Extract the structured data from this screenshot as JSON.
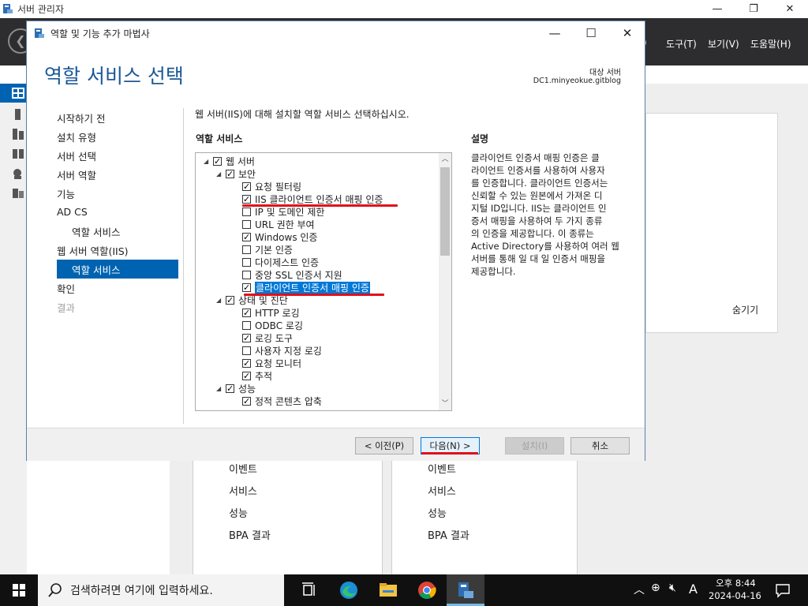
{
  "server_manager": {
    "title": "서버 관리자",
    "menu": [
      "도구(T)",
      "보기(V)",
      "도움말(H)"
    ],
    "partial_menu": ")",
    "hide_label": "숨기기",
    "tiles": [
      {
        "links": [
          "이벤트",
          "서비스",
          "성능",
          "BPA 결과"
        ]
      },
      {
        "links": [
          "이벤트",
          "서비스",
          "성능",
          "BPA 결과"
        ]
      }
    ]
  },
  "wizard": {
    "title": "역할 및 기능 추가 마법사",
    "heading": "역할 서비스 선택",
    "destination_label": "대상 서버",
    "destination_value": "DC1.minyeokue.gitblog",
    "nav": [
      "시작하기 전",
      "설치 유형",
      "서버 선택",
      "서버 역할",
      "기능",
      "AD CS",
      "역할 서비스",
      "웹 서버 역할(IIS)",
      "역할 서비스",
      "확인",
      "결과"
    ],
    "instruction": "웹 서버(IIS)에 대해 설치할 역할 서비스 선택하십시오.",
    "role_services_header": "역할 서비스",
    "description_header": "설명",
    "tree": [
      {
        "label": "웹 서버",
        "checked": true,
        "level": 0,
        "expander": true
      },
      {
        "label": "보안",
        "checked": true,
        "level": 1,
        "expander": true
      },
      {
        "label": "요청 필터링",
        "checked": true,
        "level": 2
      },
      {
        "label": "IIS 클라이언트 인증서 매핑 인증",
        "checked": true,
        "level": 2
      },
      {
        "label": "IP 및 도메인 제한",
        "checked": false,
        "level": 2
      },
      {
        "label": "URL 권한 부여",
        "checked": false,
        "level": 2
      },
      {
        "label": "Windows 인증",
        "checked": true,
        "level": 2
      },
      {
        "label": "기본 인증",
        "checked": false,
        "level": 2
      },
      {
        "label": "다이제스트 인증",
        "checked": false,
        "level": 2
      },
      {
        "label": "중앙 SSL 인증서 지원",
        "checked": false,
        "level": 2
      },
      {
        "label": "클라이언트 인증서 매핑 인증",
        "checked": true,
        "level": 2,
        "selected": true
      },
      {
        "label": "상태 및 진단",
        "checked": true,
        "level": 1,
        "expander": true
      },
      {
        "label": "HTTP 로깅",
        "checked": true,
        "level": 2
      },
      {
        "label": "ODBC 로깅",
        "checked": false,
        "level": 2
      },
      {
        "label": "로깅 도구",
        "checked": true,
        "level": 2
      },
      {
        "label": "사용자 지정 로깅",
        "checked": false,
        "level": 2
      },
      {
        "label": "요청 모니터",
        "checked": true,
        "level": 2
      },
      {
        "label": "추적",
        "checked": true,
        "level": 2
      },
      {
        "label": "성능",
        "checked": true,
        "level": 1,
        "expander": true
      },
      {
        "label": "정적 콘텐츠 압축",
        "checked": true,
        "level": 2
      }
    ],
    "description": [
      "클라이언트 인증서 매핑 인증은 클",
      "라이언트 인증서를 사용하여 사용자",
      "를 인증합니다. 클라이언트 인증서는",
      "신뢰할 수 있는 원본에서 가져온 디",
      "지털 ID입니다. IIS는 클라이언트 인",
      "증서 매핑을 사용하여 두 가지 종류",
      "의 인증을 제공합니다. 이 종류는",
      "Active Directory를 사용하여 여러 웹",
      "서버를 통해 일 대 일 인증서 매핑을",
      "제공합니다."
    ],
    "buttons": {
      "prev": "< 이전(P)",
      "next": "다음(N) >",
      "install": "설치(I)",
      "cancel": "취소"
    }
  },
  "taskbar": {
    "search_placeholder": "검색하려면 여기에 입력하세요.",
    "time": "오후 8:44",
    "date": "2024-04-16",
    "ime": "A"
  },
  "colors": {
    "accent": "#0063b1",
    "heading": "#1c5896",
    "highlight": "#0078d7",
    "annotation": "#e0101a"
  }
}
